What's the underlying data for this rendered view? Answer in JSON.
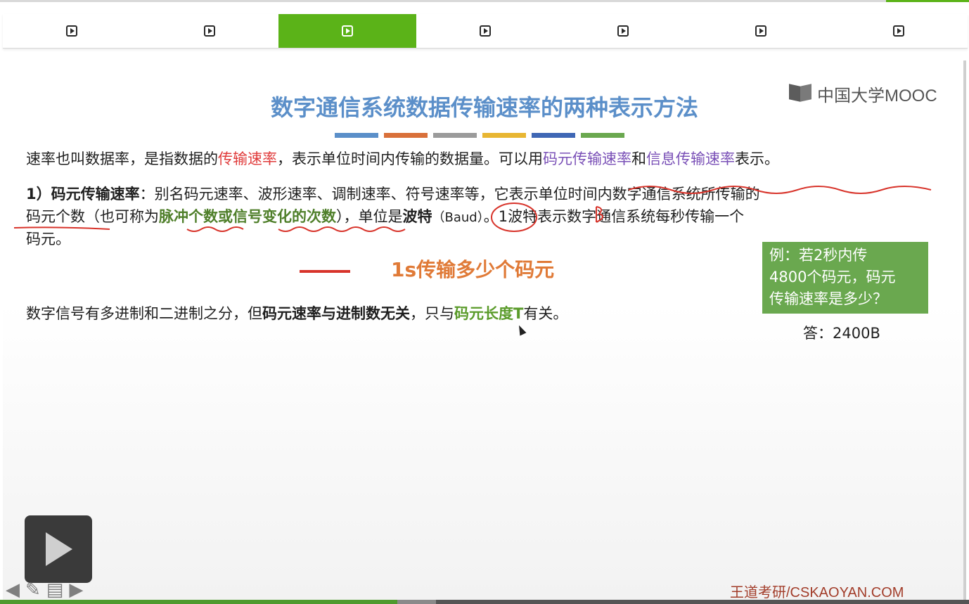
{
  "tabs": [
    {
      "icon": "play-square-icon",
      "active": false
    },
    {
      "icon": "play-square-icon",
      "active": false
    },
    {
      "icon": "play-square-icon",
      "active": true
    },
    {
      "icon": "play-square-icon",
      "active": false
    },
    {
      "icon": "play-square-icon",
      "active": false
    },
    {
      "icon": "play-square-icon",
      "active": false
    },
    {
      "icon": "play-square-icon",
      "active": false
    }
  ],
  "logo": {
    "text": "中国大学MOOC",
    "icon": "book-icon"
  },
  "slide": {
    "title": "数字通信系统数据传输速率的两种表示方法",
    "title_bar_colors": [
      "#5b8fc9",
      "#d9703a",
      "#9b9b9b",
      "#e8b632",
      "#3f67b5",
      "#6aa84f"
    ],
    "p1": {
      "t1": "速率也叫数据率，是指数据的",
      "t2": "传输速率",
      "t3": "，表示单位时间内传输的数据量。可以用",
      "t4": "码元传输速率",
      "t5": "和",
      "t6": "信息传输速率",
      "t7": "表示。"
    },
    "p2": {
      "line1_head": "1）码元传输速率",
      "line1_rest": "：别名码元速率、波形速率、调制速率、符号速率等，它表示单位时间内数字通信系统所传输的",
      "line2_a": "码元个数（也可称为",
      "line2_b": "脉冲个数或信号变化的次数",
      "line2_c": "），单位是",
      "line2_d": "波特",
      "line2_e": "（Baud）",
      "line2_f": "。1波特表示数字通信系统每秒传输一个",
      "line3": "码元。"
    },
    "slogan": "1s传输多少个码元",
    "p3": {
      "t1": "数字信号有多进制和二进制之分，但",
      "t2": "码元速率与进制数无关",
      "t3": "，只与",
      "t4": "码元长度T",
      "t5": "有关。"
    },
    "example": {
      "line1": "例：若2秒内传",
      "line2": "4800个码元，码元",
      "line3": "传输速率是多少？"
    },
    "answer": "答：2400B",
    "footer_brand": "王道考研/CSKAOYAN.COM"
  },
  "player": {
    "play_icon": "play-icon",
    "tools": [
      {
        "icon": "arrow-left-icon",
        "glyph": "◀"
      },
      {
        "icon": "pen-icon",
        "glyph": "✎"
      },
      {
        "icon": "note-icon",
        "glyph": "▤"
      },
      {
        "icon": "arrow-right-icon",
        "glyph": "▶"
      }
    ],
    "progress": 0.41,
    "buffered": 0.45,
    "colors": {
      "accent": "#5bb318",
      "progress": "#4f9a2e"
    }
  }
}
